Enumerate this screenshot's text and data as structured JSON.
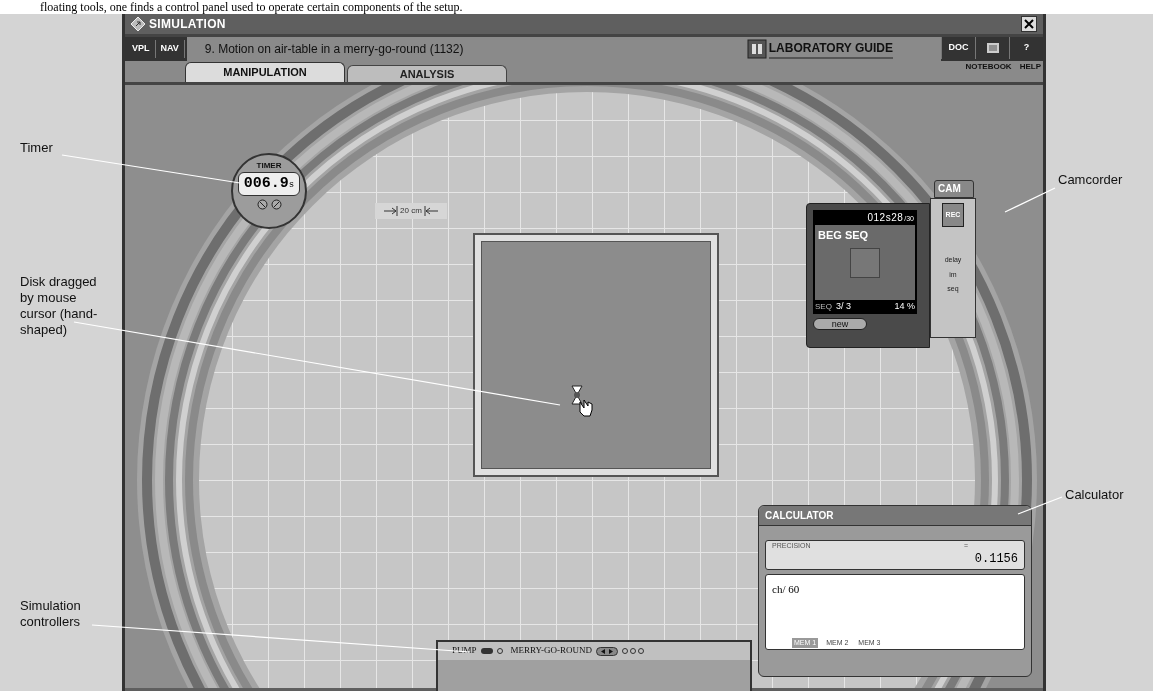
{
  "caption": "floating tools, one finds a control panel used to operate certain components of the setup.",
  "window": {
    "title": "SIMULATION"
  },
  "header": {
    "nav_buttons": [
      "VPL",
      "NAV"
    ],
    "experiment_title": "9. Motion on air-table in a merry-go-round (1132)",
    "guide": "LABORATORY GUIDE",
    "right_buttons": [
      {
        "kind": "text",
        "label": "DOC"
      },
      {
        "kind": "icon",
        "caption": "NOTEBOOK"
      },
      {
        "kind": "text",
        "label": "?",
        "caption": "HELP"
      }
    ]
  },
  "tabs": [
    {
      "label": "MANIPULATION",
      "selected": true
    },
    {
      "label": "ANALYSIS",
      "selected": false
    }
  ],
  "timer": {
    "title": "TIMER",
    "reading": "006.9",
    "unit": "s"
  },
  "scale": {
    "label": "20 cm"
  },
  "camcorder": {
    "title": "CAM",
    "counter": "012s28",
    "fps": "/30",
    "overlay": "BEG SEQ",
    "seq_label": "SEQ",
    "seq": "3/ 3",
    "percent": "14 %",
    "new_button": "new",
    "rec_button": "REC",
    "delay_label": "delay",
    "im_label": "im",
    "seq_nav_label": "seq"
  },
  "calculator": {
    "title": "CALCULATOR",
    "precision_label": "PRECISION",
    "equals": "=",
    "result": "0.1156",
    "expression": "ch/ 60",
    "memories": [
      {
        "label": "MEM 1",
        "selected": true
      },
      {
        "label": "MEM 2",
        "selected": false
      },
      {
        "label": "MEM 3",
        "selected": false
      }
    ]
  },
  "control_panel": {
    "pump": "PUMP",
    "pump_on": true,
    "merry_go_round": "MERRY-GO-ROUND"
  },
  "annotations": [
    {
      "text": "Timer"
    },
    {
      "text": "Disk dragged by mouse cursor (hand-shaped)"
    },
    {
      "text": "Simulation controllers"
    },
    {
      "text": "Camcorder"
    },
    {
      "text": "Calculator"
    }
  ]
}
